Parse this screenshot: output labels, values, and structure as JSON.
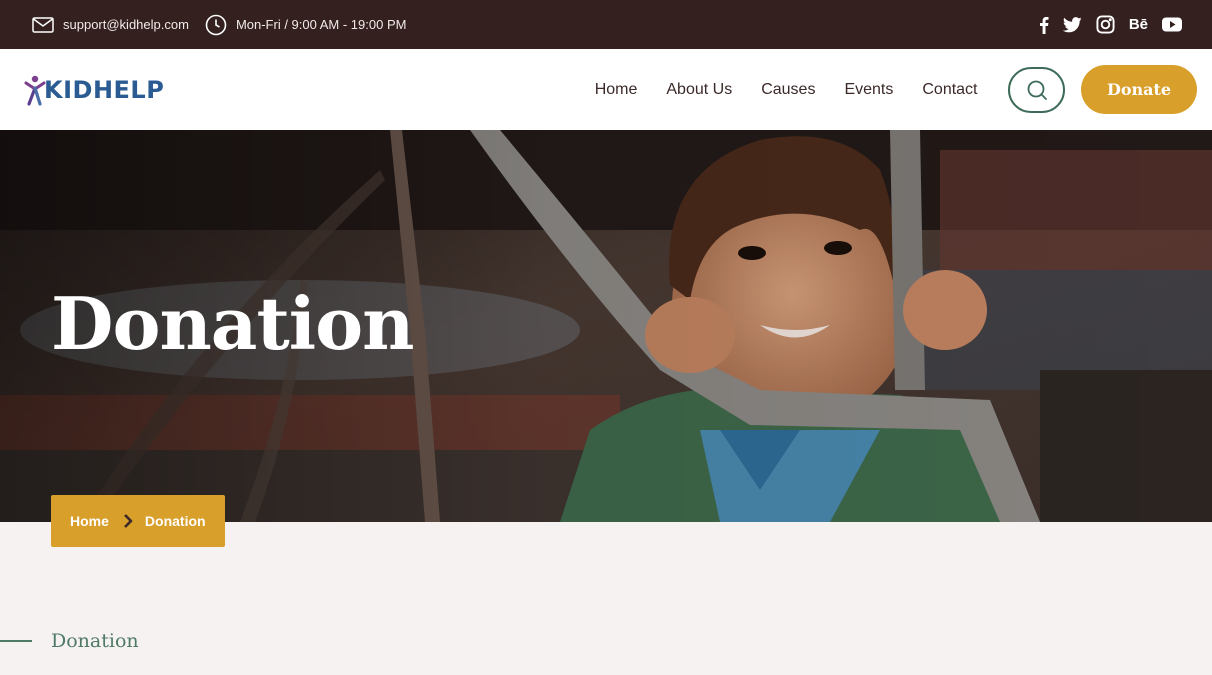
{
  "topbar": {
    "email": "support@kidhelp.com",
    "hours": "Mon-Fri / 9:00 AM - 19:00 PM",
    "social_icons": [
      "facebook-icon",
      "twitter-icon",
      "instagram-icon",
      "behance-icon",
      "youtube-icon"
    ],
    "behance_text": "Bē"
  },
  "header": {
    "logo_text": "KIDHELP",
    "nav": [
      "Home",
      "About Us",
      "Causes",
      "Events",
      "Contact"
    ],
    "donate_label": "Donate"
  },
  "hero": {
    "title": "Donation"
  },
  "breadcrumb": {
    "home": "Home",
    "current": "Donation"
  },
  "section": {
    "label": "Donation"
  },
  "colors": {
    "topbar_bg": "#33201f",
    "accent": "#d99f2b",
    "green": "#4f7a66",
    "logo_blue": "#2a5b92",
    "page_bg": "#f5f2f1"
  }
}
